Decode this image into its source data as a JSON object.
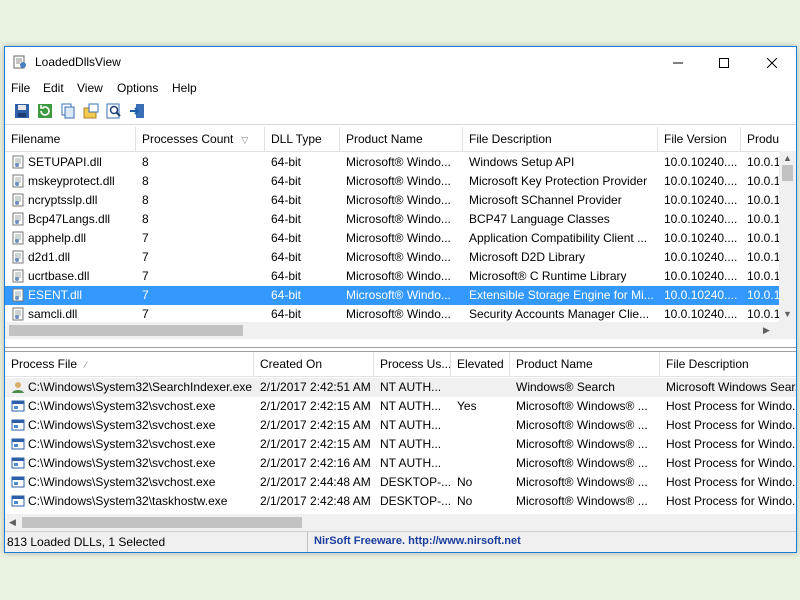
{
  "window": {
    "title": "LoadedDllsView"
  },
  "menu": [
    "File",
    "Edit",
    "View",
    "Options",
    "Help"
  ],
  "toolbar": [
    {
      "icon": "save-icon"
    },
    {
      "icon": "refresh-icon"
    },
    {
      "icon": "copy-icon"
    },
    {
      "icon": "properties-icon"
    },
    {
      "icon": "find-icon"
    },
    {
      "icon": "exit-icon"
    }
  ],
  "dll_table": {
    "columns": [
      "Filename",
      "Processes Count",
      "DLL Type",
      "Product Name",
      "File Description",
      "File Version",
      "Produ"
    ],
    "rows": [
      [
        "SETUPAPI.dll",
        "8",
        "64-bit",
        "Microsoft® Windo...",
        "Windows Setup API",
        "10.0.10240....",
        "10.0.1("
      ],
      [
        "mskeyprotect.dll",
        "8",
        "64-bit",
        "Microsoft® Windo...",
        "Microsoft Key Protection Provider",
        "10.0.10240....",
        "10.0.1("
      ],
      [
        "ncryptsslp.dll",
        "8",
        "64-bit",
        "Microsoft® Windo...",
        "Microsoft SChannel Provider",
        "10.0.10240....",
        "10.0.1("
      ],
      [
        "Bcp47Langs.dll",
        "8",
        "64-bit",
        "Microsoft® Windo...",
        "BCP47 Language Classes",
        "10.0.10240....",
        "10.0.1("
      ],
      [
        "apphelp.dll",
        "7",
        "64-bit",
        "Microsoft® Windo...",
        "Application Compatibility Client ...",
        "10.0.10240....",
        "10.0.1("
      ],
      [
        "d2d1.dll",
        "7",
        "64-bit",
        "Microsoft® Windo...",
        "Microsoft D2D Library",
        "10.0.10240....",
        "10.0.1("
      ],
      [
        "ucrtbase.dll",
        "7",
        "64-bit",
        "Microsoft® Windo...",
        "Microsoft® C Runtime Library",
        "10.0.10240....",
        "10.0.1("
      ],
      [
        "ESENT.dll",
        "7",
        "64-bit",
        "Microsoft® Windo...",
        "Extensible Storage Engine for Mi...",
        "10.0.10240....",
        "10.0.1("
      ],
      [
        "samcli.dll",
        "7",
        "64-bit",
        "Microsoft® Windo...",
        "Security Accounts Manager Clie...",
        "10.0.10240....",
        "10.0.1("
      ]
    ],
    "selected_index": 7
  },
  "process_table": {
    "columns": [
      "Process File",
      "Created On",
      "Process Us...",
      "Elevated",
      "Product Name",
      "File Description"
    ],
    "rows": [
      [
        "C:\\Windows\\System32\\SearchIndexer.exe",
        "2/1/2017 2:42:51 AM",
        "NT AUTH...",
        "",
        "Windows® Search",
        "Microsoft Windows Sear..."
      ],
      [
        "C:\\Windows\\System32\\svchost.exe",
        "2/1/2017 2:42:15 AM",
        "NT AUTH...",
        "Yes",
        "Microsoft® Windows® ...",
        "Host Process for Windo..."
      ],
      [
        "C:\\Windows\\System32\\svchost.exe",
        "2/1/2017 2:42:15 AM",
        "NT AUTH...",
        "",
        "Microsoft® Windows® ...",
        "Host Process for Windo..."
      ],
      [
        "C:\\Windows\\System32\\svchost.exe",
        "2/1/2017 2:42:15 AM",
        "NT AUTH...",
        "",
        "Microsoft® Windows® ...",
        "Host Process for Windo..."
      ],
      [
        "C:\\Windows\\System32\\svchost.exe",
        "2/1/2017 2:42:16 AM",
        "NT AUTH...",
        "",
        "Microsoft® Windows® ...",
        "Host Process for Windo..."
      ],
      [
        "C:\\Windows\\System32\\svchost.exe",
        "2/1/2017 2:44:48 AM",
        "DESKTOP-...",
        "No",
        "Microsoft® Windows® ...",
        "Host Process for Windo..."
      ],
      [
        "C:\\Windows\\System32\\taskhostw.exe",
        "2/1/2017 2:42:48 AM",
        "DESKTOP-...",
        "No",
        "Microsoft® Windows® ...",
        "Host Process for Windo..."
      ]
    ]
  },
  "status": {
    "summary": "813 Loaded DLLs, 1 Selected",
    "link": "NirSoft Freeware.  http://www.nirsoft.net"
  }
}
